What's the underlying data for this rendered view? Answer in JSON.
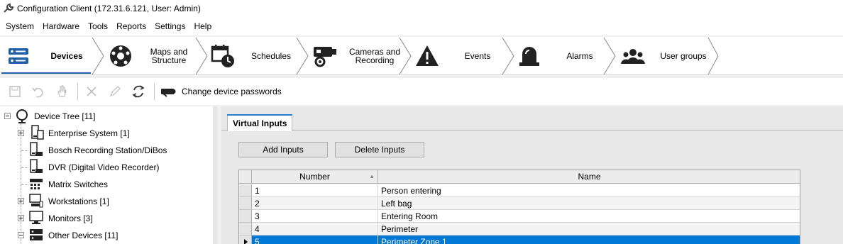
{
  "window": {
    "title": "Configuration Client (172.31.6.121, User: Admin)"
  },
  "menu": [
    "System",
    "Hardware",
    "Tools",
    "Reports",
    "Settings",
    "Help"
  ],
  "nav_tabs": [
    {
      "label": "Devices",
      "icon": "devices-icon",
      "active": true
    },
    {
      "label": "Maps and\nStructure",
      "icon": "maps-structure-icon",
      "active": false
    },
    {
      "label": "Schedules",
      "icon": "schedules-icon",
      "active": false
    },
    {
      "label": "Cameras and\nRecording",
      "icon": "cameras-recording-icon",
      "active": false
    },
    {
      "label": "Events",
      "icon": "events-icon",
      "active": false
    },
    {
      "label": "Alarms",
      "icon": "alarms-icon",
      "active": false
    },
    {
      "label": "User groups",
      "icon": "user-groups-icon",
      "active": false
    }
  ],
  "toolbar": {
    "buttons": [
      "save-icon",
      "undo-icon",
      "help-hand-icon",
      "delete-icon",
      "edit-icon",
      "refresh-icon"
    ],
    "change_passwords_label": "Change device passwords"
  },
  "tree": {
    "root": "Device Tree [11]",
    "items": [
      {
        "label": "Enterprise System [1]",
        "icon": "enterprise-system-icon",
        "expandable": true
      },
      {
        "label": "Bosch Recording Station/DiBos",
        "icon": "recording-station-icon",
        "expandable": false
      },
      {
        "label": "DVR (Digital Video Recorder)",
        "icon": "dvr-icon",
        "expandable": false
      },
      {
        "label": "Matrix Switches",
        "icon": "matrix-switch-icon",
        "expandable": false
      },
      {
        "label": "Workstations [1]",
        "icon": "workstation-icon",
        "expandable": true
      },
      {
        "label": "Monitors [3]",
        "icon": "monitor-icon",
        "expandable": true
      },
      {
        "label": "Other Devices [11]",
        "icon": "other-devices-icon",
        "expandable": true,
        "expanded": true
      }
    ]
  },
  "panel": {
    "tab_label": "Virtual Inputs",
    "add_button": "Add Inputs",
    "delete_button": "Delete Inputs",
    "columns": [
      "Number",
      "Name"
    ],
    "rows": [
      {
        "number": "1",
        "name": "Person entering"
      },
      {
        "number": "2",
        "name": "Left bag"
      },
      {
        "number": "3",
        "name": "Entering Room"
      },
      {
        "number": "4",
        "name": "Perimeter"
      },
      {
        "number": "5",
        "name": "Perimeter Zone 1",
        "selected": true
      }
    ]
  },
  "colors": {
    "accent": "#0078d7",
    "nav_underline": "#1f5fa8",
    "tab_top": "#2b7bd0"
  }
}
